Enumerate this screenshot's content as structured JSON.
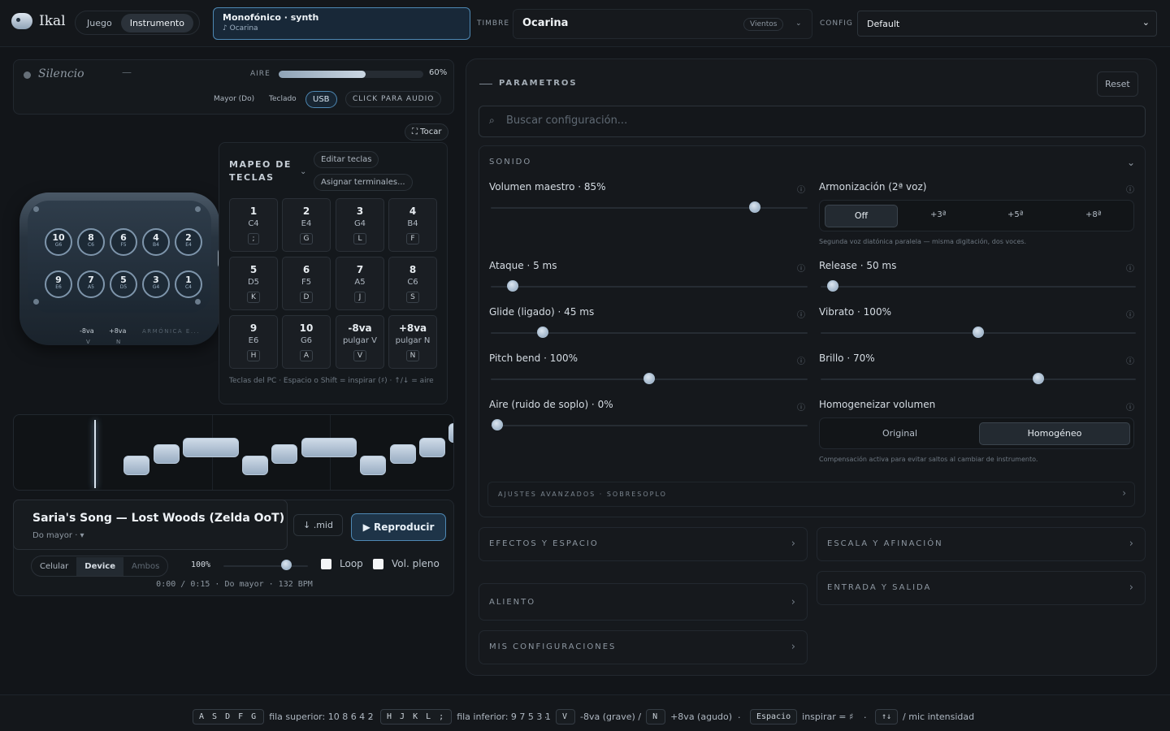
{
  "header": {
    "app_name": "Ikal",
    "tabs": [
      "Juego",
      "Instrumento"
    ],
    "mode_title": "Monofónico · synth",
    "mode_sub": "♪ Ocarina",
    "timbre_label": "TIMBRE",
    "timbre_value": "Ocarina",
    "timbre_tag": "Vientos",
    "config_label": "CONFIG",
    "config_value": "Default"
  },
  "status": {
    "state": "Silencio",
    "dash": "—",
    "air_label": "AIRE",
    "air_value": "60%",
    "air_fraction": 0.6,
    "chips": [
      "Mayor (Do)",
      "Teclado",
      "USB",
      "CLICK PARA AUDIO"
    ]
  },
  "tocar": "⛶ Tocar",
  "mapping": {
    "title": "MAPEO DE TECLAS",
    "edit": "Editar teclas",
    "assign": "Asignar terminales...",
    "keys": [
      {
        "n": "1",
        "note": "C4",
        "key": ";"
      },
      {
        "n": "2",
        "note": "E4",
        "key": "G"
      },
      {
        "n": "3",
        "note": "G4",
        "key": "L"
      },
      {
        "n": "4",
        "note": "B4",
        "key": "F"
      },
      {
        "n": "5",
        "note": "D5",
        "key": "K"
      },
      {
        "n": "6",
        "note": "F5",
        "key": "D"
      },
      {
        "n": "7",
        "note": "A5",
        "key": "J"
      },
      {
        "n": "8",
        "note": "C6",
        "key": "S"
      },
      {
        "n": "9",
        "note": "E6",
        "key": "H"
      },
      {
        "n": "10",
        "note": "G6",
        "key": "A"
      },
      {
        "n": "-8va",
        "note": "pulgar V",
        "key": "V"
      },
      {
        "n": "+8va",
        "note": "pulgar N",
        "key": "N"
      }
    ],
    "hint": "Teclas del PC · Espacio o Shift = inspirar (♯) · ↑/↓ = aire"
  },
  "ocarina": {
    "top_row": [
      {
        "n": "10",
        "l": "G6"
      },
      {
        "n": "8",
        "l": "C6"
      },
      {
        "n": "6",
        "l": "F5"
      },
      {
        "n": "4",
        "l": "B4"
      },
      {
        "n": "2",
        "l": "E4"
      }
    ],
    "bottom_row": [
      {
        "n": "9",
        "l": "E6"
      },
      {
        "n": "7",
        "l": "A5"
      },
      {
        "n": "5",
        "l": "D5"
      },
      {
        "n": "3",
        "l": "G4"
      },
      {
        "n": "1",
        "l": "C4"
      }
    ],
    "down": "-8va",
    "down_key": "V",
    "up": "+8va",
    "up_key": "N",
    "brand": "ARMÓNICA E..."
  },
  "player": {
    "song": "Saria's Song — Lost Woods (Zelda OoT)",
    "key": "Do mayor · ▾",
    "mid": "↓ .mid",
    "play": "▶ Reproducir",
    "targets": [
      "Celular",
      "Device",
      "Ambos"
    ],
    "speed": "100%",
    "loop": "Loop",
    "full_vol": "Vol. pleno",
    "meta": "0:00 / 0:15 · Do mayor · 132 BPM"
  },
  "params": {
    "title": "PARAMETROS",
    "reset": "Reset",
    "search_placeholder": "Buscar configuración...",
    "sound_title": "SONIDO",
    "volumen": "Volumen maestro · 85%",
    "armonizacion": "Armonización (2ª voz)",
    "harm_options": [
      "Off",
      "+3ª",
      "+5ª",
      "+8ª"
    ],
    "harm_hint": "Segunda voz diatónica paralela — misma digitación, dos voces.",
    "ataque": "Ataque · 5 ms",
    "release": "Release · 50 ms",
    "glide": "Glide (ligado) · 45 ms",
    "vibrato": "Vibrato · 100%",
    "pitch": "Pitch bend · 100%",
    "brillo": "Brillo · 70%",
    "aire": "Aire (ruido de soplo) · 0%",
    "homog": "Homogeneizar volumen",
    "homog_options": [
      "Original",
      "Homogéneo"
    ],
    "homog_hint": "Compensación activa para evitar saltos al cambiar de instrumento.",
    "advanced": "AJUSTES AVANZADOS · SOBRESOPLO",
    "sections": [
      "EFECTOS Y ESPACIO",
      "ESCALA Y AFINACIÓN",
      "ALIENTO",
      "ENTRADA Y SALIDA",
      "MIS CONFIGURACIONES"
    ]
  },
  "footer": {
    "top_keys": "A S D F G",
    "top_desc": "fila superior: 10 8 6 4 2",
    "bot_keys": "H J K L ;",
    "bot_desc": "fila inferior: 9 7 5 3 1",
    "v_key": "V",
    "v_desc": "-8va (grave) /",
    "n_key": "N",
    "n_desc": "+8va (agudo)",
    "space_key": "Espacio",
    "space_desc": "inspirar = ♯",
    "arrows_key": "↑↓",
    "arrows_desc": "/ mic intensidad"
  },
  "colors": {
    "accent": "#4e88b3",
    "bg": "#121519"
  }
}
